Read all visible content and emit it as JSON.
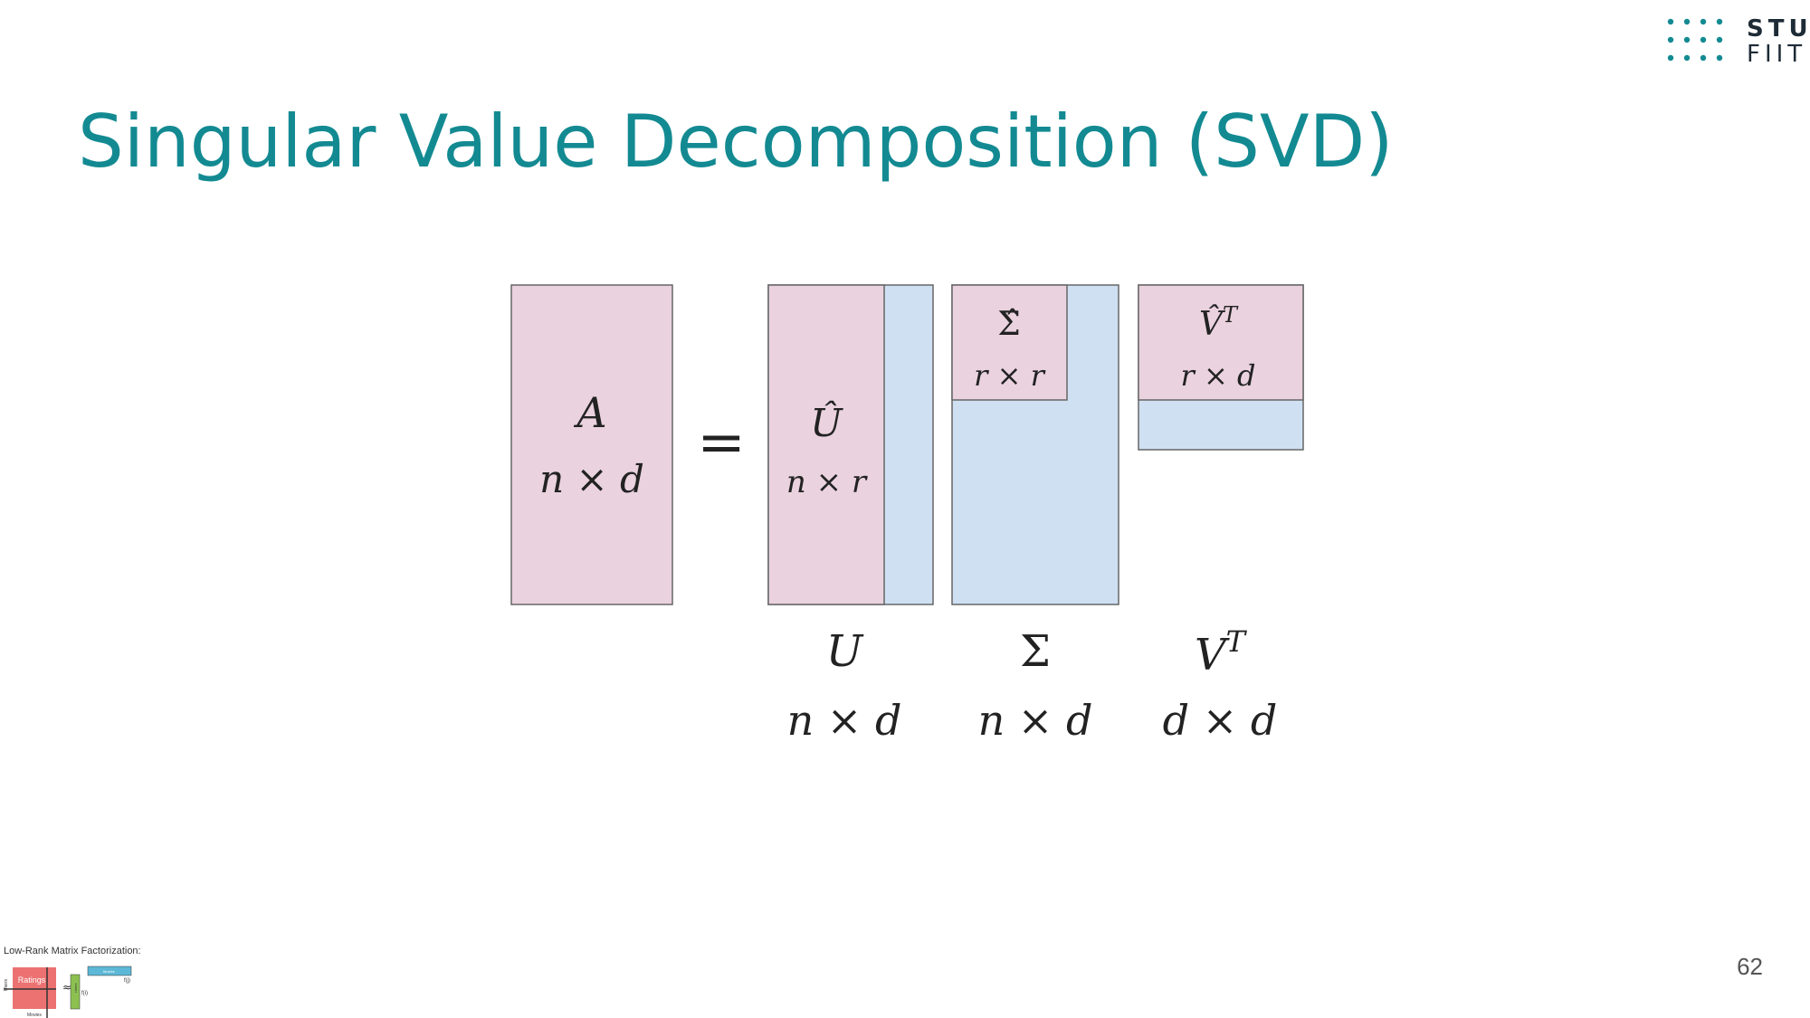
{
  "logo": {
    "line1": "STU",
    "line2": "FIIT",
    "color": "#138a92"
  },
  "slide": {
    "title": "Singular Value Decomposition (SVD)",
    "page_number": "62"
  },
  "colors": {
    "title": "#138a92",
    "pink": "#ead2de",
    "blue": "#cfe0f2",
    "border": "#666666"
  },
  "diagram": {
    "equals": "=",
    "A": {
      "symbol": "A",
      "dims": "n × d"
    },
    "U_hat": {
      "symbol": "Û",
      "dims": "n × r"
    },
    "Sigma_hat": {
      "symbol": "Σ̂",
      "dims": "r × r"
    },
    "Vt_hat": {
      "symbol": "V̂",
      "sup": "T",
      "dims": "r × d"
    },
    "U": {
      "symbol": "U",
      "dims": "n × d"
    },
    "Sigma": {
      "symbol": "Σ",
      "dims": "n × d"
    },
    "Vt": {
      "symbol": "V",
      "sup": "T",
      "dims": "d × d"
    }
  },
  "thumbnail": {
    "caption": "Low-Rank Matrix Factorization:",
    "ratings": "Ratings",
    "users": "Users",
    "movies": "Movies",
    "approx": "≈",
    "users_small": "Users",
    "movies_small": "Movies",
    "f1": "f(i)",
    "f2": "f(j)"
  }
}
